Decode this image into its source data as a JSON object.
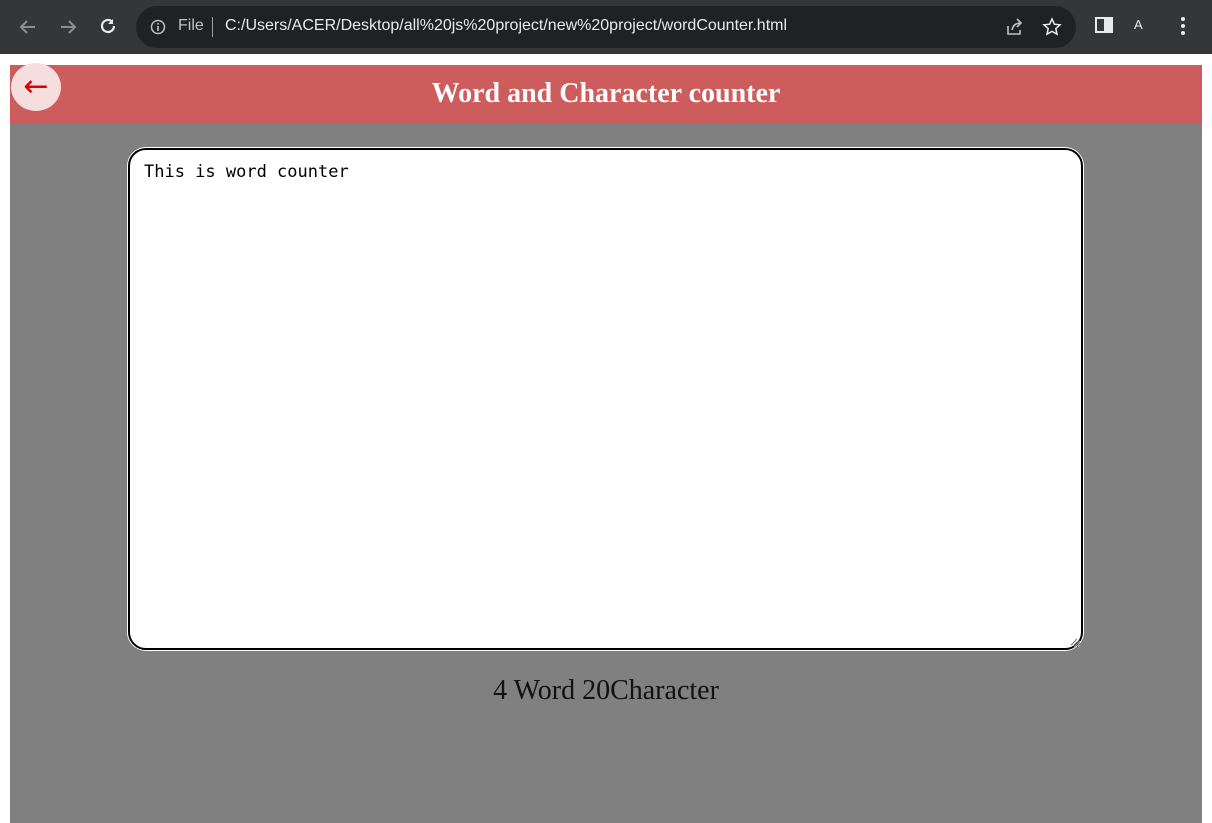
{
  "browser": {
    "file_label": "File",
    "url": "C:/Users/ACER/Desktop/all%20js%20project/new%20project/wordCounter.html",
    "profile_letter": "A",
    "icons": {
      "back": "arrow-left-icon",
      "forward": "arrow-right-icon",
      "reload": "reload-icon",
      "info": "info-icon",
      "share": "share-icon",
      "bookmark": "star-icon",
      "side_panel": "side-panel-icon",
      "menu": "kebab-menu-icon"
    }
  },
  "page": {
    "title": "Word and Character counter",
    "back_button_glyph": "←",
    "textarea_value": "This is word counter",
    "result_text": "4 Word 20Character",
    "colors": {
      "header": "#cd5c5c",
      "background": "#808080",
      "back_button_bg": "#f6dede",
      "back_arrow": "#e00000"
    }
  }
}
